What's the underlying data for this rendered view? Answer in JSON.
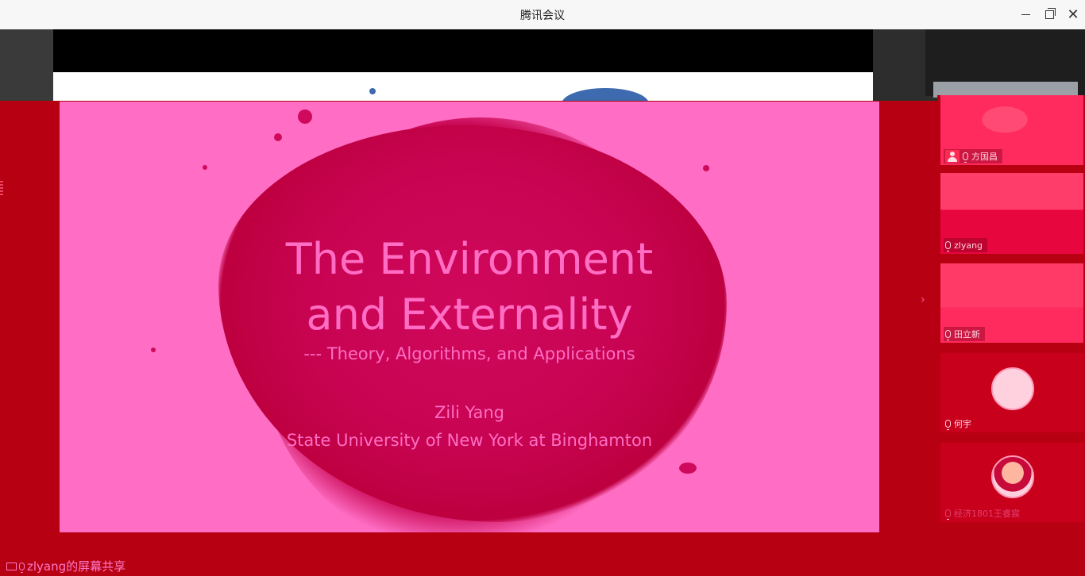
{
  "window": {
    "title": "腾讯会议",
    "minimize_label": "",
    "maximize_label": "",
    "close_label": "✕"
  },
  "slide": {
    "title_line1": "The Environment",
    "title_line2": "and Externality",
    "subtitle": "--- Theory, Algorithms, and Applications",
    "author": "Zili Yang",
    "affiliation": "State University of New York at Binghamton"
  },
  "participants": [
    {
      "name": "方国昌",
      "type": "video",
      "host": true
    },
    {
      "name": "zlyang",
      "type": "video"
    },
    {
      "name": "田立新",
      "type": "video"
    },
    {
      "name": "何宇",
      "type": "avatar"
    },
    {
      "name": "经济1801王睿宸",
      "type": "avatar"
    }
  ],
  "status": {
    "sharing_text": "zlyang的屏幕共享"
  },
  "colors": {
    "overlay": "#b70012",
    "slide_bg": "#ff6ec4",
    "splash": "#c5004b",
    "text": "#ff6ec4"
  },
  "icons": {
    "mic": "mic-icon",
    "screen_share": "screen-share-icon",
    "next": "chevron-right-icon"
  }
}
